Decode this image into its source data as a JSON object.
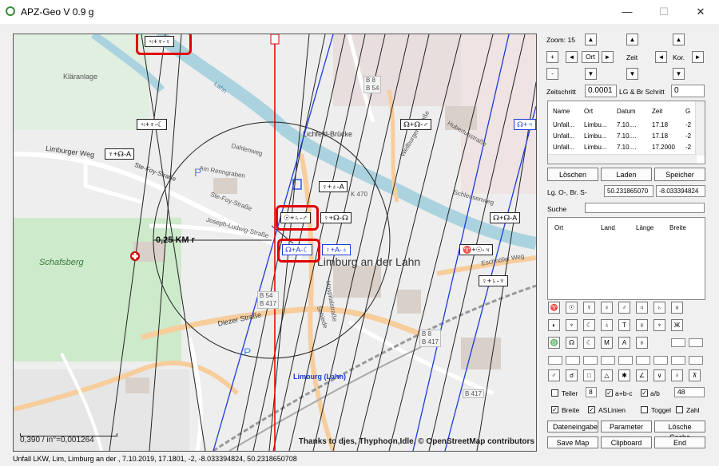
{
  "window": {
    "title": "APZ-Geo V 0.9 g",
    "minimize": "—",
    "maximize": "☐",
    "close": "✕"
  },
  "map": {
    "labels": {
      "klaeranlage": "Kläranlage",
      "lahn_river": "Lahn",
      "limburger_weg": "Limburger Weg",
      "ste_foy_strasse": "Ste-Foy-Straße",
      "am_renngraben": "Am Renngraben",
      "dahlenweg": "Dahlenweg",
      "joseph_ludwig": "Joseph-Ludwig-Straße",
      "schafsberg": "Schafsberg",
      "diezer_strasse": "Diezer Straße",
      "limburg_an_der_lahn": "Limburg an der Lahn",
      "lichfeld_bruecke": "Lichfeld-Brücke",
      "limburg_lahn_station": "Limburg (Lahn)",
      "schiede": "Schiede",
      "hospitalstrasse": "Hospitalstraße",
      "b8_b54_top": "B 8\nB 54",
      "b54_b417": "B 54\nB 417",
      "b8_b417": "B 8\nB 417",
      "b417": "B 417",
      "k470": "K 470",
      "parking_1": "P",
      "parking_2": "P",
      "radius": "0,25 KM r",
      "hubertusstrasse": "Hubertusstraße",
      "schleusenweg": "Schleusenweg",
      "eschhofer_weg": "Eschhöfer Weg",
      "weilburger_strasse": "Weilburger Straße"
    },
    "symbols": [
      {
        "text": "♃+♆-♀",
        "highlight": true,
        "color": "black"
      },
      {
        "text": "♃+♆-☾",
        "highlight": false,
        "color": "black"
      },
      {
        "text": "♆+☊-A",
        "highlight": false,
        "color": "black"
      },
      {
        "text": "☊+☊-♂",
        "highlight": false,
        "color": "black"
      },
      {
        "text": "☊+♃",
        "highlight": false,
        "color": "blue"
      },
      {
        "text": "♀+♁-A",
        "highlight": false,
        "color": "black"
      },
      {
        "text": "☉+♄-♂",
        "highlight": true,
        "color": "black"
      },
      {
        "text": "♀+☊-☊",
        "highlight": false,
        "color": "black"
      },
      {
        "text": "☊+A-☾",
        "highlight": true,
        "color": "blue"
      },
      {
        "text": "♀+A-♁",
        "highlight": false,
        "color": "blue"
      },
      {
        "text": "☊+☊-A",
        "highlight": false,
        "color": "black"
      },
      {
        "text": "♈+☉-♃",
        "highlight": false,
        "color": "black"
      },
      {
        "text": "♀+♄-♆",
        "highlight": false,
        "color": "black"
      }
    ],
    "scale_text": "0,390 / in°=0,001264",
    "attribution": "Thanks to djes, Thyphoon,Idle, © OpenStreetMap contributors"
  },
  "controls": {
    "zoom_label": "Zoom:",
    "zoom_value": "15",
    "up": "▲",
    "down": "▼",
    "left": "◄",
    "right": "►",
    "plus": "+",
    "minus": "-",
    "ort": "Ort",
    "zeit": "Zeit",
    "kor": "Kor.",
    "zeitschritt_label": "Zeitschritt",
    "zeitschritt_value": "0.0001",
    "lgbr_label": "LG & Br Schritt",
    "lgbr_value": "0"
  },
  "table1": {
    "headers": [
      "Name",
      "Ort",
      "Datum",
      "Zeit",
      "G"
    ],
    "rows": [
      [
        "Unfall...",
        "Limbu...",
        "7.10....",
        "17.18",
        "-2"
      ],
      [
        "Unfall...",
        "Limbu...",
        "7.10....",
        "17.18",
        "-2"
      ],
      [
        "Unfall...",
        "Limbu...",
        "7.10....",
        "17.2000",
        "-2"
      ]
    ]
  },
  "buttons": {
    "loeschen": "Löschen",
    "laden": "Laden",
    "speicher": "Speicher",
    "dateneingabe": "Dateneingabe",
    "parameter": "Parameter",
    "loesche_cache": "Lösche Cache",
    "save_map": "Save Map",
    "clipboard": "Clipboard",
    "end": "End"
  },
  "coords": {
    "label": "Lg. O-, Br. S-",
    "lg": "50.231865070",
    "br": "-8.033394824"
  },
  "search": {
    "label": "Suche",
    "value": ""
  },
  "table2": {
    "headers": [
      "Ort",
      "Land",
      "Länge",
      "Breite"
    ]
  },
  "symbol_buttons": {
    "row1": [
      "♈",
      "☉",
      "☿",
      "♀",
      "♂",
      "♃",
      "♄",
      "♅"
    ],
    "row2": [
      "◐",
      "♆",
      "☾",
      "♁",
      "T",
      "♅",
      "♆",
      "Ж"
    ],
    "row3": [
      "♎",
      "☊",
      "☾",
      "M",
      "A",
      "♅"
    ],
    "row4": [
      "♂",
      "☌",
      "□",
      "△",
      "✱",
      "∠",
      "∨",
      "♀",
      "⊼"
    ]
  },
  "options": {
    "teiler_label": "Teiler",
    "teiler_value": "8",
    "abc_label": "a+b-c",
    "ab_label": "a/b",
    "num_value": "48",
    "breite_label": "Breite",
    "aslinien_label": "ASLinien",
    "toggle_label": "Toggel",
    "zahl_label": "Zahl",
    "check": "✓"
  },
  "status": "Unfall LKW, Lim, Limburg an der , 7.10.2019, 17.1801, -2, -8.033394824, 50.2318650708",
  "colors": {
    "accent_red": "#e00000",
    "line_blue": "#1a3cd8",
    "line_red": "#e00000"
  }
}
